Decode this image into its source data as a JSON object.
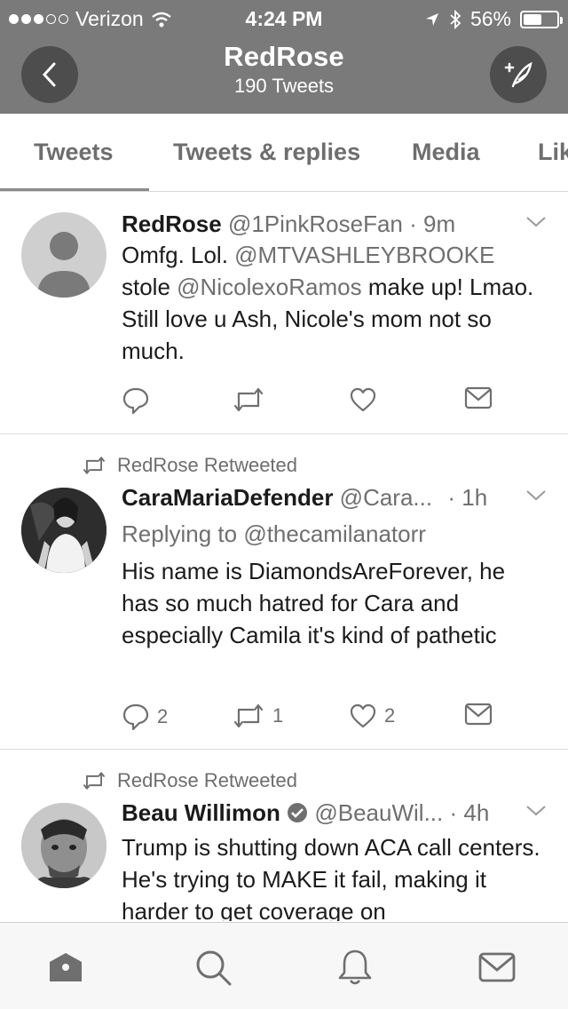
{
  "status_bar": {
    "carrier": "Verizon",
    "time": "4:24 PM",
    "battery": "56%",
    "battery_level": 0.56
  },
  "header": {
    "title": "RedRose",
    "subtitle": "190 Tweets"
  },
  "tabs": [
    {
      "label": "Tweets",
      "active": true
    },
    {
      "label": "Tweets & replies"
    },
    {
      "label": "Media"
    },
    {
      "label": "Lik"
    }
  ],
  "tweets": [
    {
      "name": "RedRose",
      "handle": "@1PinkRoseFan",
      "sep": "·",
      "time": "9m",
      "body_parts": [
        "Omfg. Lol. ",
        "@MTVASHLEYBROOKE",
        " stole ",
        "@NicolexoRamos",
        " make up! Lmao. Still love u Ash, Nicole's mom not so much."
      ]
    },
    {
      "retweeted_by": "RedRose Retweeted",
      "name": "CaraMariaDefender",
      "handle": "@Cara...",
      "sep": "·",
      "time": "1h",
      "reply_label": "Replying to ",
      "reply_handle": "@thecamilanatorr",
      "body": "His name is DiamondsAreForever, he has so much hatred for Cara and especially Camila it's kind of pathetic",
      "replies": "2",
      "retweets": "1",
      "likes": "2"
    },
    {
      "retweeted_by": "RedRose Retweeted",
      "name": "Beau Willimon",
      "handle": "@BeauWil...",
      "sep": "·",
      "time": "4h",
      "body": "Trump is shutting down ACA call centers. He's trying to MAKE it fail, making it harder to get coverage on"
    }
  ],
  "bottom_nav": [
    "home-icon",
    "search-icon",
    "notifications-icon",
    "messages-icon"
  ]
}
